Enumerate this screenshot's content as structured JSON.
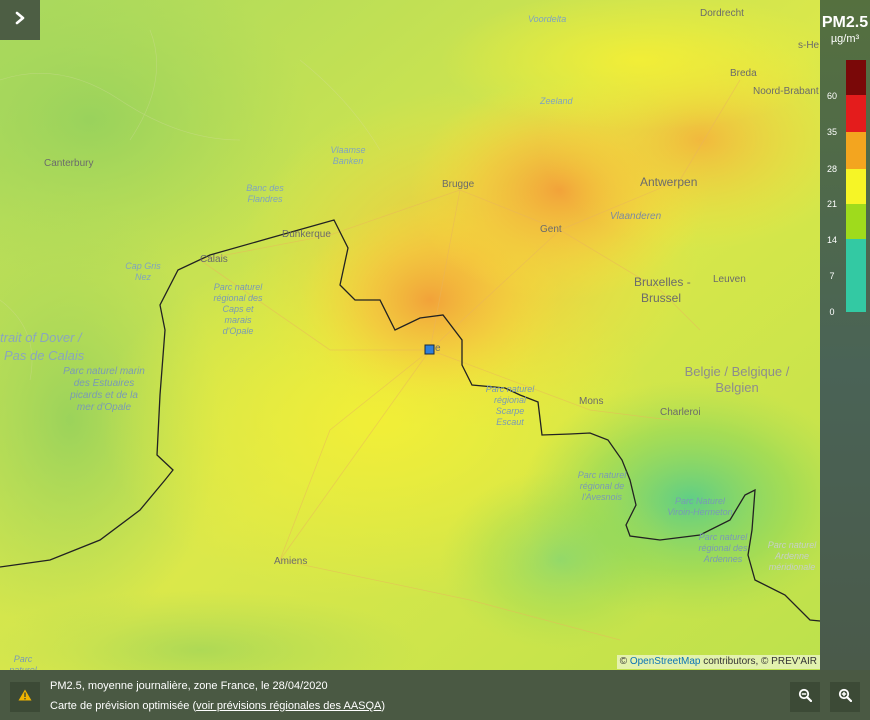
{
  "pollutant": "PM2.5",
  "unit": "µg/m³",
  "legend": {
    "ticks": [
      "60",
      "35",
      "28",
      "21",
      "14",
      "7",
      "0"
    ],
    "colors": [
      "#7a0808",
      "#e41c1c",
      "#f3a51f",
      "#f6f526",
      "#9fdb1c",
      "#33c9a3"
    ]
  },
  "map_labels": {
    "countries": [
      "Belgie / Belgique /",
      "Belgien"
    ],
    "water": {
      "strait_1": "trait of Dover /",
      "strait_2": "Pas de Calais",
      "vlaamse_banken": "Vlaamse Banken",
      "banc_des_flandres": "Banc des Flandres",
      "cap_gris_nez": "Cap Gris Nez",
      "zeeland": "Zeeland"
    },
    "cities": {
      "canterbury": "Canterbury",
      "calais": "Calais",
      "dunkerque": "Dunkerque",
      "brugge": "Brugge",
      "gent": "Gent",
      "antwerpen": "Antwerpen",
      "vlaanderen": "Vlaanderen",
      "bruxelles": "Bruxelles -",
      "brussel": "Brussel",
      "leuven": "Leuven",
      "mons": "Mons",
      "charleroi": "Charleroi",
      "amiens": "Amiens",
      "breda": "Breda",
      "dordrecht": "Dordrecht",
      "noord_brabant": "Noord-Brabant",
      "voordelta": "Voordelta",
      "s_hertogenbosch": "s-He",
      "lille_fragment": "e"
    },
    "parks": {
      "caps_marais": "Parc naturel régional des Caps et marais d'Opale",
      "estuaires": "Parc naturel marin des Estuaires picards et de la mer d'Opale",
      "scarpe_escaut": "Parc naturel régional Scarpe Escaut",
      "avesnois": "Parc naturel régional de l'Avesnois",
      "viroin": "Parc Naturel Viroin-Hermeton",
      "ardennes": "Parc naturel régional des Ardennes",
      "ardenne_meridionale": "Parc naturel Ardenne méridionale",
      "bottom_left": "Parc naturel"
    }
  },
  "attribution": {
    "prefix": "© ",
    "link": "OpenStreetMap",
    "suffix": " contributors, © PREV'AIR"
  },
  "footer": {
    "caption_line1": "PM2.5, moyenne journalière, zone France, le 28/04/2020",
    "caption_line2_prefix": "Carte de prévision optimisée (",
    "caption_line2_link": "voir prévisions régionales des AASQA",
    "caption_line2_suffix": ")"
  },
  "icons": {
    "toggle": "chevron-right-icon",
    "warning": "warning-icon",
    "zoom_out": "zoom-out-icon",
    "zoom_in": "zoom-in-icon"
  }
}
